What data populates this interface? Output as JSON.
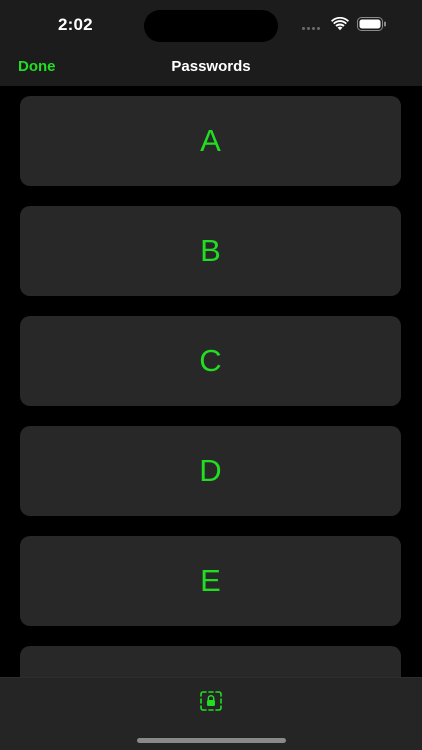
{
  "status_bar": {
    "time": "2:02"
  },
  "header": {
    "done_label": "Done",
    "title": "Passwords"
  },
  "list": {
    "items": [
      {
        "label": "A"
      },
      {
        "label": "B"
      },
      {
        "label": "C"
      },
      {
        "label": "D"
      },
      {
        "label": "E"
      },
      {
        "label": ""
      }
    ]
  },
  "tab_bar": {
    "icon": "lock-screen-icon"
  },
  "colors": {
    "accent": "#22dd22",
    "header_background": "#1c1c1c",
    "card_background": "#282828",
    "page_background": "#000000",
    "tab_bar_background": "#252525"
  }
}
